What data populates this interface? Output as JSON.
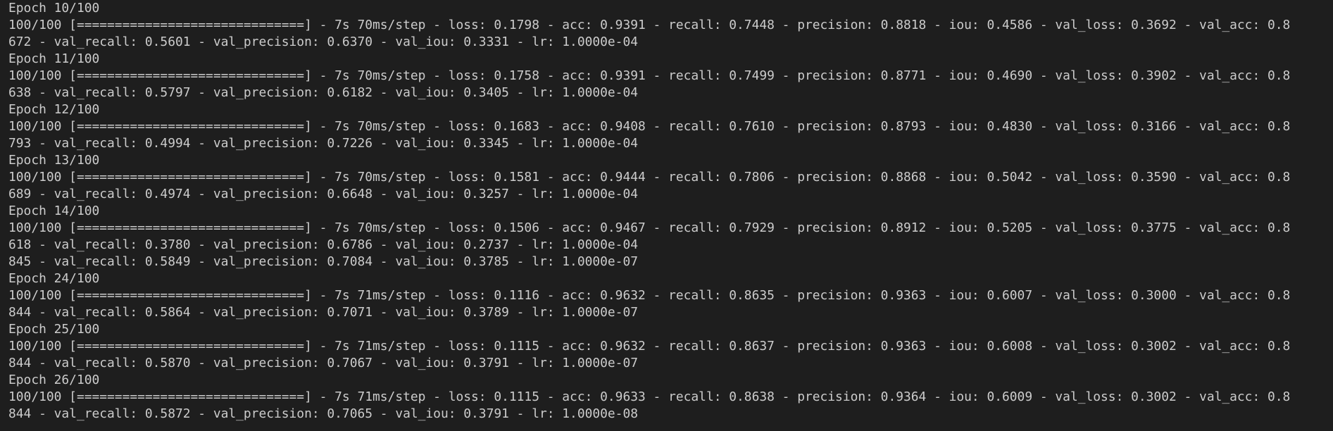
{
  "terminal": {
    "lines": [
      "Epoch 10/100",
      "100/100 [==============================] - 7s 70ms/step - loss: 0.1798 - acc: 0.9391 - recall: 0.7448 - precision: 0.8818 - iou: 0.4586 - val_loss: 0.3692 - val_acc: 0.8",
      "672 - val_recall: 0.5601 - val_precision: 0.6370 - val_iou: 0.3331 - lr: 1.0000e-04",
      "Epoch 11/100",
      "100/100 [==============================] - 7s 70ms/step - loss: 0.1758 - acc: 0.9391 - recall: 0.7499 - precision: 0.8771 - iou: 0.4690 - val_loss: 0.3902 - val_acc: 0.8",
      "638 - val_recall: 0.5797 - val_precision: 0.6182 - val_iou: 0.3405 - lr: 1.0000e-04",
      "Epoch 12/100",
      "100/100 [==============================] - 7s 70ms/step - loss: 0.1683 - acc: 0.9408 - recall: 0.7610 - precision: 0.8793 - iou: 0.4830 - val_loss: 0.3166 - val_acc: 0.8",
      "793 - val_recall: 0.4994 - val_precision: 0.7226 - val_iou: 0.3345 - lr: 1.0000e-04",
      "Epoch 13/100",
      "100/100 [==============================] - 7s 70ms/step - loss: 0.1581 - acc: 0.9444 - recall: 0.7806 - precision: 0.8868 - iou: 0.5042 - val_loss: 0.3590 - val_acc: 0.8",
      "689 - val_recall: 0.4974 - val_precision: 0.6648 - val_iou: 0.3257 - lr: 1.0000e-04",
      "Epoch 14/100",
      "100/100 [==============================] - 7s 70ms/step - loss: 0.1506 - acc: 0.9467 - recall: 0.7929 - precision: 0.8912 - iou: 0.5205 - val_loss: 0.3775 - val_acc: 0.8",
      "618 - val_recall: 0.3780 - val_precision: 0.6786 - val_iou: 0.2737 - lr: 1.0000e-04",
      "845 - val_recall: 0.5849 - val_precision: 0.7084 - val_iou: 0.3785 - lr: 1.0000e-07",
      "Epoch 24/100",
      "100/100 [==============================] - 7s 71ms/step - loss: 0.1116 - acc: 0.9632 - recall: 0.8635 - precision: 0.9363 - iou: 0.6007 - val_loss: 0.3000 - val_acc: 0.8",
      "844 - val_recall: 0.5864 - val_precision: 0.7071 - val_iou: 0.3789 - lr: 1.0000e-07",
      "Epoch 25/100",
      "100/100 [==============================] - 7s 71ms/step - loss: 0.1115 - acc: 0.9632 - recall: 0.8637 - precision: 0.9363 - iou: 0.6008 - val_loss: 0.3002 - val_acc: 0.8",
      "844 - val_recall: 0.5870 - val_precision: 0.7067 - val_iou: 0.3791 - lr: 1.0000e-07",
      "Epoch 26/100",
      "100/100 [==============================] - 7s 71ms/step - loss: 0.1115 - acc: 0.9633 - recall: 0.8638 - precision: 0.9364 - iou: 0.6009 - val_loss: 0.3002 - val_acc: 0.8",
      "844 - val_recall: 0.5872 - val_precision: 0.7065 - val_iou: 0.3791 - lr: 1.0000e-08"
    ]
  },
  "colors": {
    "background": "#1e1e1e",
    "text": "#cccccc"
  }
}
